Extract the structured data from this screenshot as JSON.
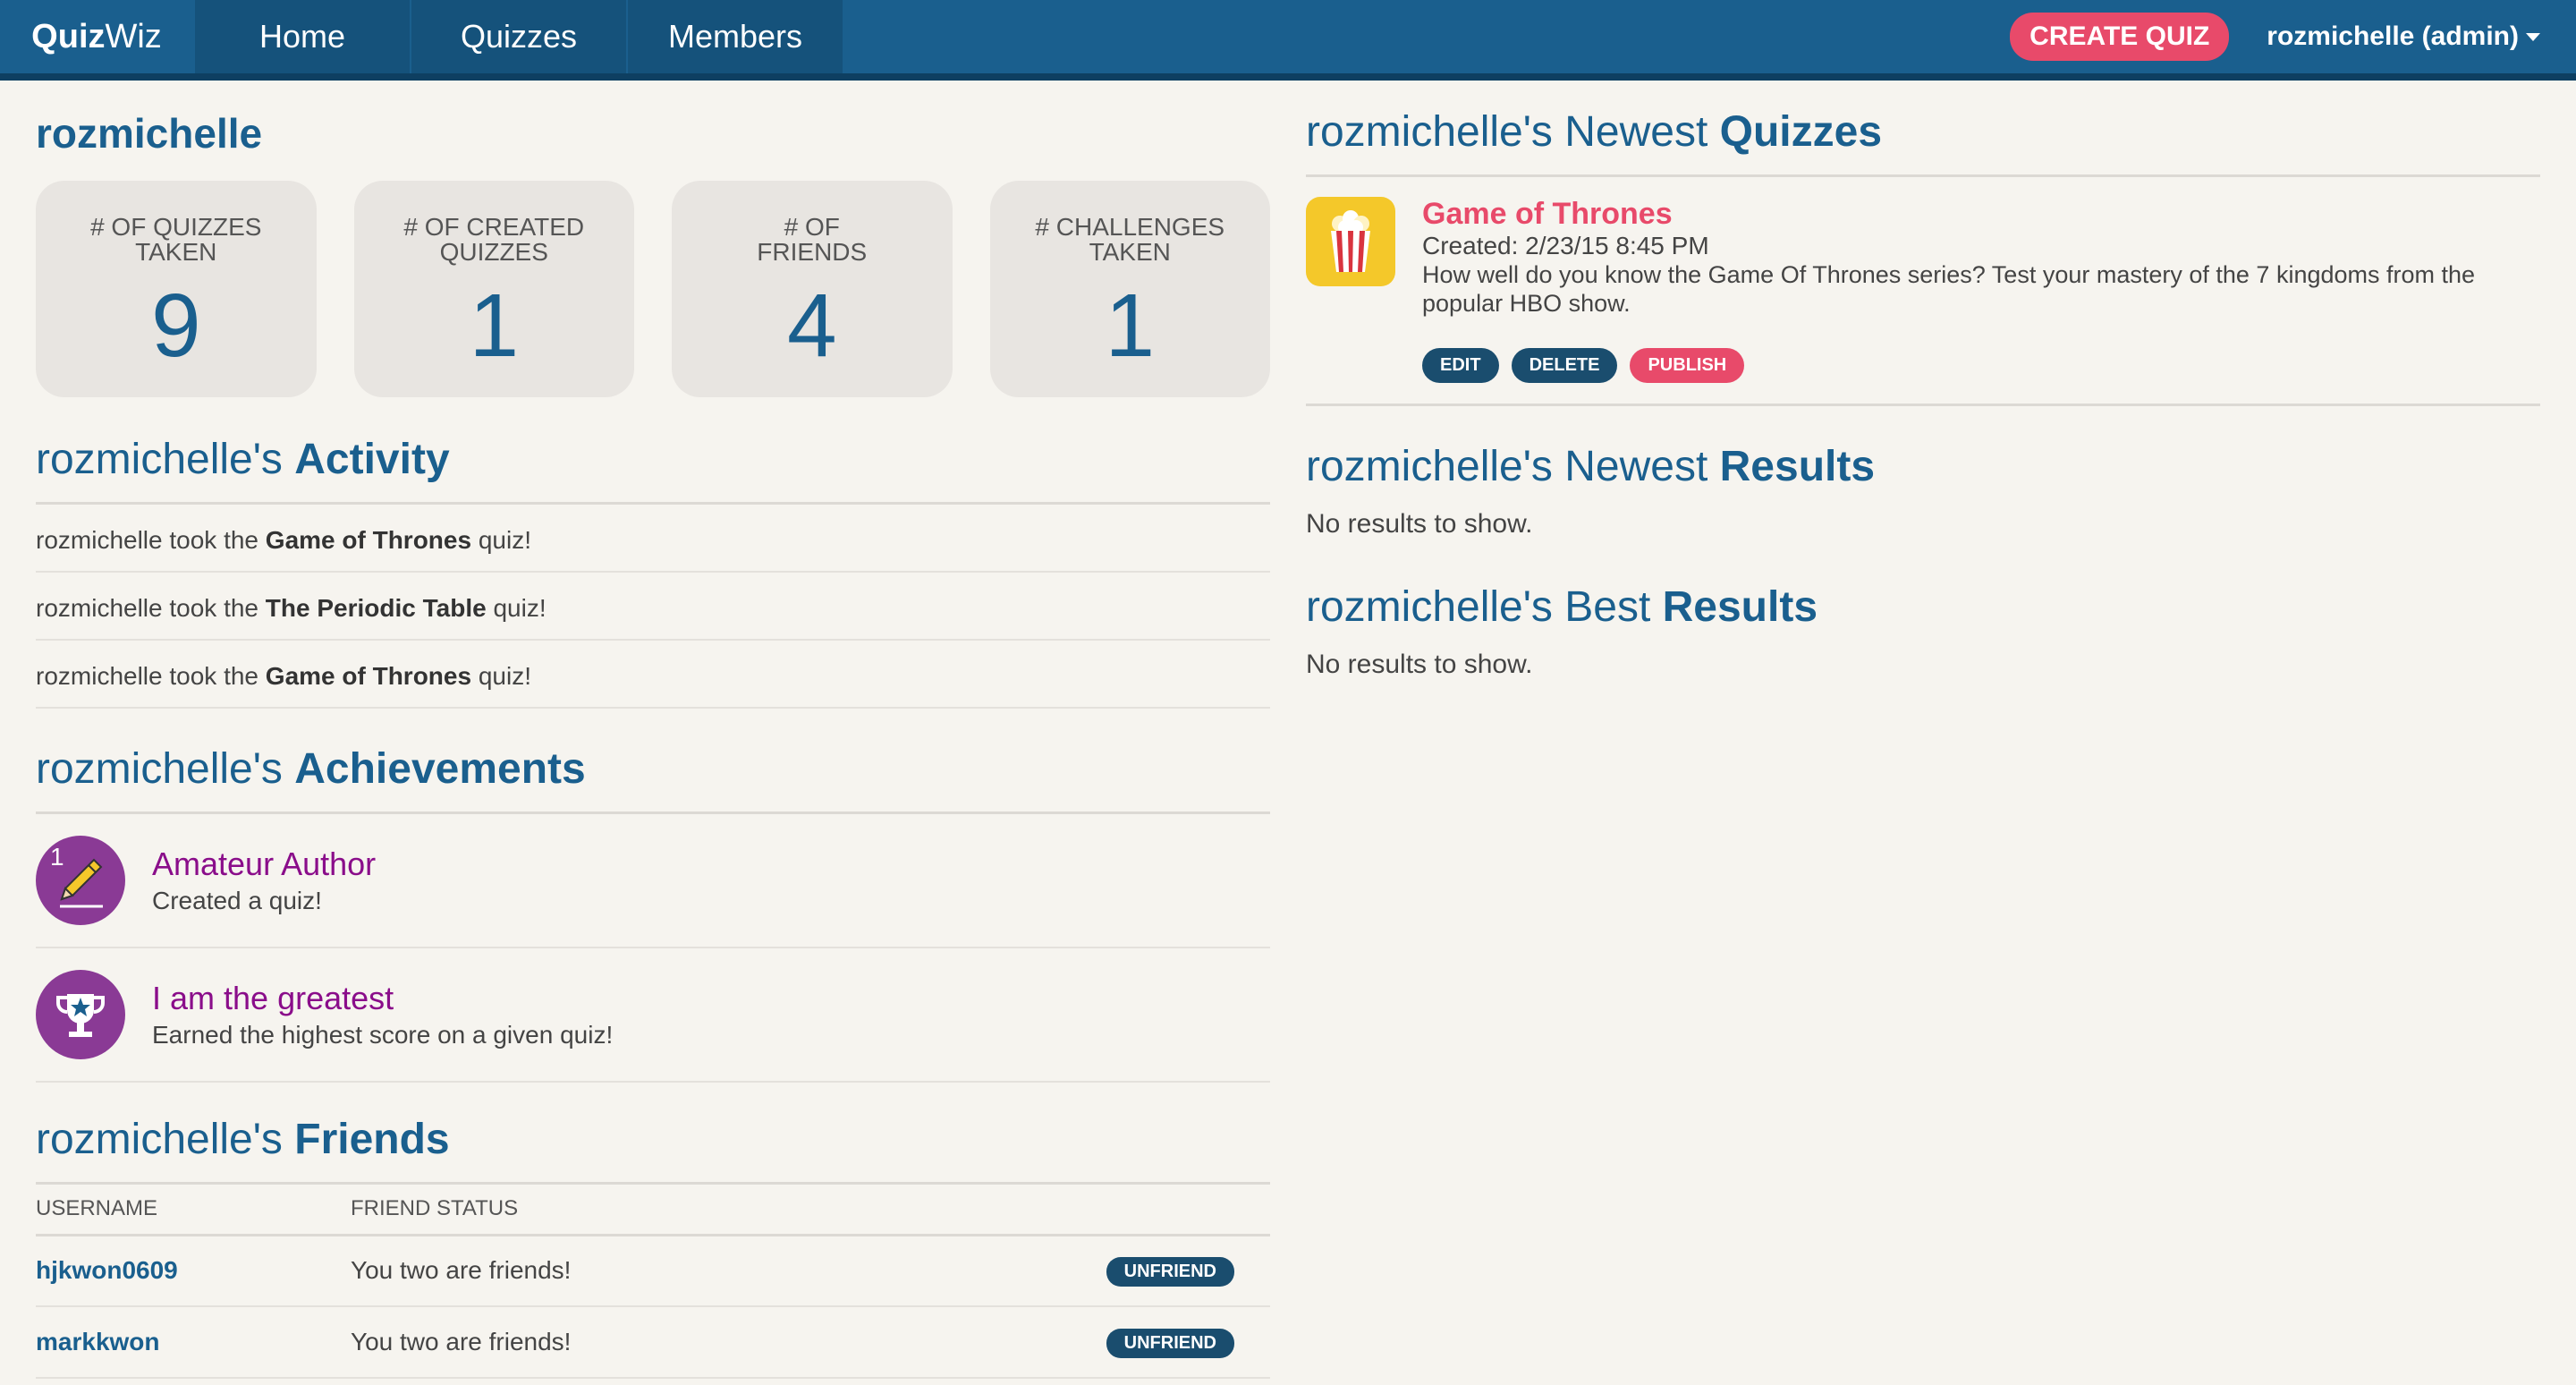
{
  "nav": {
    "brand_bold": "Quiz",
    "brand_light": "Wiz",
    "items": [
      {
        "label": "Home"
      },
      {
        "label": "Quizzes"
      },
      {
        "label": "Members"
      }
    ],
    "create_label": "CREATE QUIZ",
    "user_label": "rozmichelle (admin)"
  },
  "profile": {
    "username": "rozmichelle",
    "stats": [
      {
        "label_line1": "# OF QUIZZES",
        "label_line2": "TAKEN",
        "value": "9"
      },
      {
        "label_line1": "# OF CREATED",
        "label_line2": "QUIZZES",
        "value": "1"
      },
      {
        "label_line1": "# OF",
        "label_line2": "FRIENDS",
        "value": "4"
      },
      {
        "label_line1": "# CHALLENGES",
        "label_line2": "TAKEN",
        "value": "1"
      }
    ]
  },
  "activity": {
    "title_prefix": "rozmichelle's ",
    "title_bold": "Activity",
    "items": [
      {
        "prefix": "rozmichelle took the ",
        "quiz": "Game of Thrones",
        "suffix": " quiz!"
      },
      {
        "prefix": "rozmichelle took the ",
        "quiz": "The Periodic Table",
        "suffix": " quiz!"
      },
      {
        "prefix": "rozmichelle took the ",
        "quiz": "Game of Thrones",
        "suffix": " quiz!"
      }
    ]
  },
  "achievements": {
    "title_prefix": "rozmichelle's ",
    "title_bold": "Achievements",
    "items": [
      {
        "badge_num": "1",
        "icon": "pencil-icon",
        "title": "Amateur Author",
        "desc": "Created a quiz!"
      },
      {
        "badge_num": "",
        "icon": "trophy-icon",
        "title": "I am the greatest",
        "desc": "Earned the highest score on a given quiz!"
      }
    ]
  },
  "friends": {
    "title_prefix": "rozmichelle's ",
    "title_bold": "Friends",
    "col_username": "USERNAME",
    "col_status": "FRIEND STATUS",
    "rows": [
      {
        "username": "hjkwon0609",
        "status": "You two are friends!",
        "action": "UNFRIEND"
      },
      {
        "username": "markkwon",
        "status": "You two are friends!",
        "action": "UNFRIEND"
      }
    ]
  },
  "newest_quizzes": {
    "title_prefix": "rozmichelle's Newest ",
    "title_bold": "Quizzes",
    "quiz": {
      "icon": "popcorn-icon",
      "title": "Game of Thrones",
      "created": "Created: 2/23/15 8:45 PM",
      "description": "How well do you know the Game Of Thrones series? Test your mastery of the 7 kingdoms from the popular HBO show.",
      "edit_label": "EDIT",
      "delete_label": "DELETE",
      "publish_label": "PUBLISH"
    }
  },
  "newest_results": {
    "title_prefix": "rozmichelle's Newest ",
    "title_bold": "Results",
    "empty": "No results to show."
  },
  "best_results": {
    "title_prefix": "rozmichelle's Best ",
    "title_bold": "Results",
    "empty": "No results to show."
  },
  "colors": {
    "nav_bg": "#1a5f8e",
    "accent_pink": "#e84a6a",
    "achievement_purple": "#8a3a95",
    "stat_blue": "#1a5f8e"
  }
}
